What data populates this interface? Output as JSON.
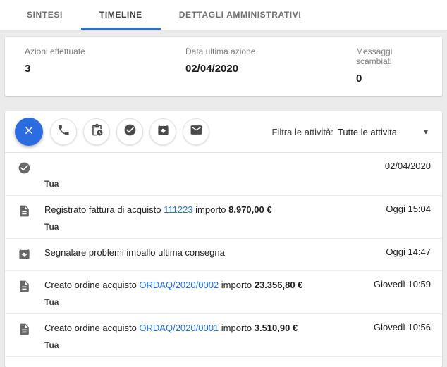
{
  "tabs": {
    "items": [
      {
        "label": "SINTESI"
      },
      {
        "label": "TIMELINE"
      },
      {
        "label": "DETTAGLI AMMINISTRATIVI"
      }
    ]
  },
  "stats": {
    "actions_label": "Azioni effettuate",
    "actions_value": "3",
    "last_action_label": "Data ultima azione",
    "last_action_value": "02/04/2020",
    "messages_label": "Messaggi scambiati",
    "messages_value": "0"
  },
  "action_buttons": {
    "icons": [
      "close",
      "phone",
      "invoice-schedule",
      "check-circle",
      "package",
      "mail"
    ]
  },
  "filter": {
    "label": "Filtra le attività:",
    "value": "Tutte le attivita"
  },
  "timeline": {
    "rows": [
      {
        "icon": "check-circle",
        "prefix": "",
        "link": "",
        "mid": "",
        "amount": "",
        "author": "Tua",
        "date": "02/04/2020"
      },
      {
        "icon": "document",
        "prefix": "Registrato fattura di acquisto ",
        "link": "111223",
        "mid": " importo ",
        "amount": "8.970,00 €",
        "author": "Tua",
        "date": "Oggi 15:04"
      },
      {
        "icon": "package",
        "prefix": "Segnalare problemi imballo ultima consegna",
        "link": "",
        "mid": "",
        "amount": "",
        "author": "",
        "date": "Oggi 14:47"
      },
      {
        "icon": "document",
        "prefix": "Creato ordine acquisto ",
        "link": "ORDAQ/2020/0002",
        "mid": " importo ",
        "amount": "23.356,80 €",
        "author": "Tua",
        "date": "Giovedì 10:59"
      },
      {
        "icon": "document",
        "prefix": "Creato ordine acquisto ",
        "link": "ORDAQ/2020/0001",
        "mid": " importo ",
        "amount": "3.510,90 €",
        "author": "Tua",
        "date": "Giovedì 10:56"
      }
    ]
  },
  "colors": {
    "accent": "#1a73e8",
    "fab": "#2b6ce0"
  }
}
